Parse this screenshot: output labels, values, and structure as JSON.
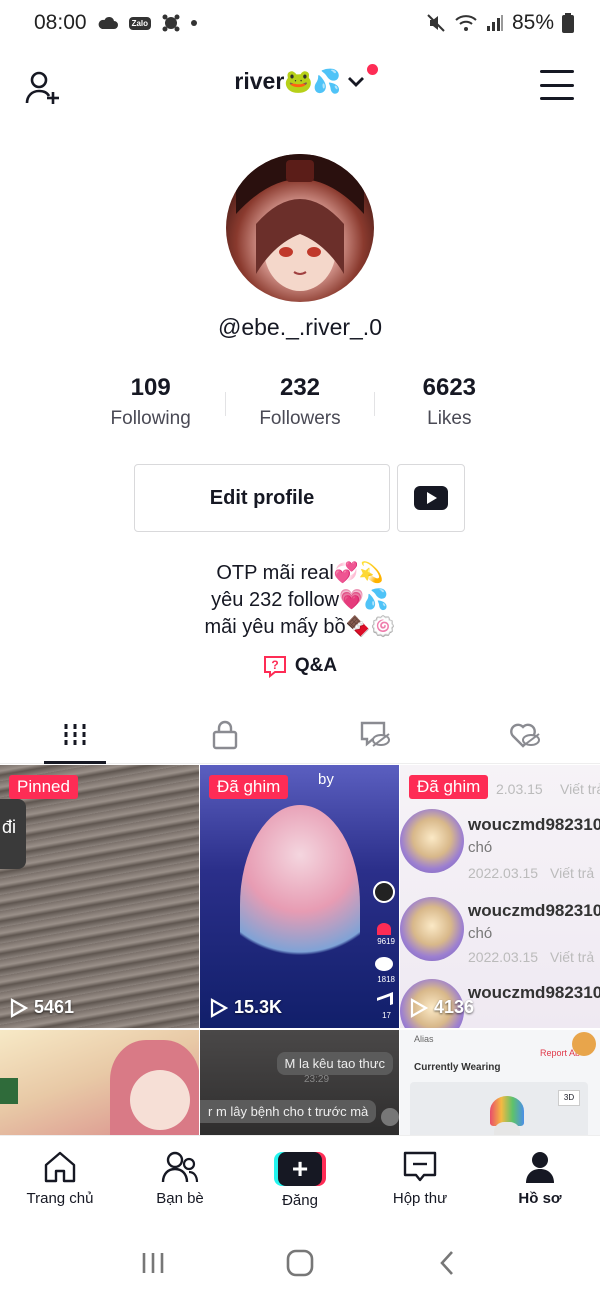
{
  "status_bar": {
    "time": "08:00",
    "battery": "85%",
    "zalo_label": "Zalo"
  },
  "header": {
    "account_name": "river🐸💦"
  },
  "profile": {
    "username": "@ebe._.river_.0",
    "stats": [
      {
        "value": "109",
        "label": "Following"
      },
      {
        "value": "232",
        "label": "Followers"
      },
      {
        "value": "6623",
        "label": "Likes"
      }
    ],
    "edit_profile_label": "Edit profile",
    "bio_lines": [
      "OTP mãi real💞💫",
      "yêu 232 follow💗💦",
      "mãi yêu mấy bồ🍫🍥"
    ],
    "qa_label": "Q&A"
  },
  "tabs": [
    {
      "icon": "grid-icon",
      "active": true
    },
    {
      "icon": "lock-icon",
      "active": false
    },
    {
      "icon": "tagged-hidden-icon",
      "active": false
    },
    {
      "icon": "liked-hidden-icon",
      "active": false
    }
  ],
  "videos": [
    {
      "badge": "Pinned",
      "views": "5461",
      "side_text": "đi"
    },
    {
      "badge": "Đã ghim",
      "views": "15.3K",
      "overlay_text": "by",
      "likes": "9619",
      "comments": "1818",
      "shares": "17"
    },
    {
      "badge": "Đã ghim",
      "views": "4136",
      "comments": [
        {
          "user": "wouczmd982310",
          "text": "chó",
          "date": "2022.03.15",
          "reply": "Viết trả"
        },
        {
          "user": "wouczmd982310",
          "text": "chó",
          "date": "2022.03.15",
          "reply": "Viết trả"
        },
        {
          "user": "wouczmd982310"
        }
      ],
      "top_date": "2.03.15",
      "top_reply": "Viết trả"
    },
    {
      "badge": "",
      "views": ""
    },
    {
      "badge": "",
      "views": "",
      "bubble_1": "M la kêu tao thưc",
      "bubble_1_time": "23:29",
      "bubble_2": "r m lây bệnh cho t trước mà"
    },
    {
      "badge": "",
      "views": "",
      "alias_label": "Alias",
      "report_label": "Report Ab",
      "wearing_label": "Currently Wearing",
      "badge_3d": "3D"
    }
  ],
  "bottom_nav": [
    {
      "label": "Trang chủ",
      "icon": "home-icon"
    },
    {
      "label": "Bạn bè",
      "icon": "friends-icon"
    },
    {
      "label": "Đăng",
      "icon": "create-icon"
    },
    {
      "label": "Hộp thư",
      "icon": "inbox-icon"
    },
    {
      "label": "Hồ sơ",
      "icon": "profile-icon",
      "active": true
    }
  ],
  "colors": {
    "accent": "#fe2c55",
    "cyan": "#25f4ee",
    "text": "#161823"
  }
}
